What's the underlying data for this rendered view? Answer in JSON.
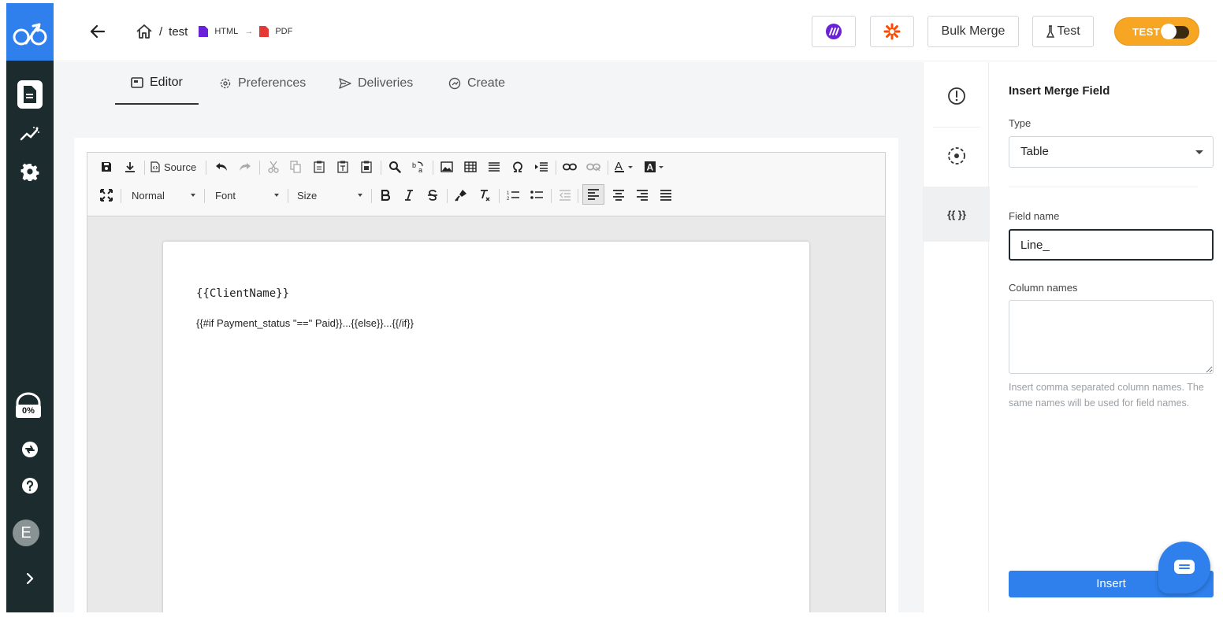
{
  "header": {
    "breadcrumb_name": "test",
    "breadcrumb_sep": "/",
    "from_format": "HTML",
    "to_format": "PDF",
    "arrow": "→",
    "bulk_merge_label": "Bulk Merge",
    "test_button_label": "Test",
    "toggle_label": "TEST",
    "icons": [
      "back-arrow-icon",
      "home-icon",
      "html-file-icon",
      "pdf-file-icon",
      "make-icon",
      "zapier-icon",
      "test-flask-icon"
    ]
  },
  "leftnav": {
    "items": [
      "document-icon",
      "analytics-icon",
      "gear-icon"
    ],
    "usage_label": "0%",
    "avatar_initial": "E",
    "bottom_icons": [
      "sync-icon",
      "help-icon",
      "chevron-right-icon"
    ]
  },
  "tabs": [
    {
      "label": "Editor",
      "icon": "editor-icon",
      "active": true
    },
    {
      "label": "Preferences",
      "icon": "gear-icon",
      "active": false
    },
    {
      "label": "Deliveries",
      "icon": "send-icon",
      "active": false
    },
    {
      "label": "Create",
      "icon": "create-icon",
      "active": false
    }
  ],
  "toolbar": {
    "source_label": "Source",
    "format_select": "Normal",
    "font_select": "Font",
    "size_select": "Size"
  },
  "document": {
    "line1": "{{ClientName}}",
    "line2": "{{#if Payment_status \"==\" Paid}}...{{else}}...{{/if}}"
  },
  "iconcol": {
    "items": [
      {
        "name": "alert-icon"
      },
      {
        "name": "target-icon"
      },
      {
        "name": "merge-field-icon",
        "label": "{{ }}"
      }
    ]
  },
  "panel": {
    "title": "Insert Merge Field",
    "type_label": "Type",
    "type_value": "Table",
    "field_name_label": "Field name",
    "field_name_value": "Line_",
    "column_names_label": "Column names",
    "help_text": "Insert comma separated column names. The same names will be used for field names.",
    "insert_label": "Insert"
  },
  "colors": {
    "brand_blue": "#2f80ed",
    "nav_dark": "#1c2b2d",
    "toggle_orange": "#f6a623",
    "make_purple": "#6b21d9",
    "zapier_orange": "#ff4a00"
  }
}
